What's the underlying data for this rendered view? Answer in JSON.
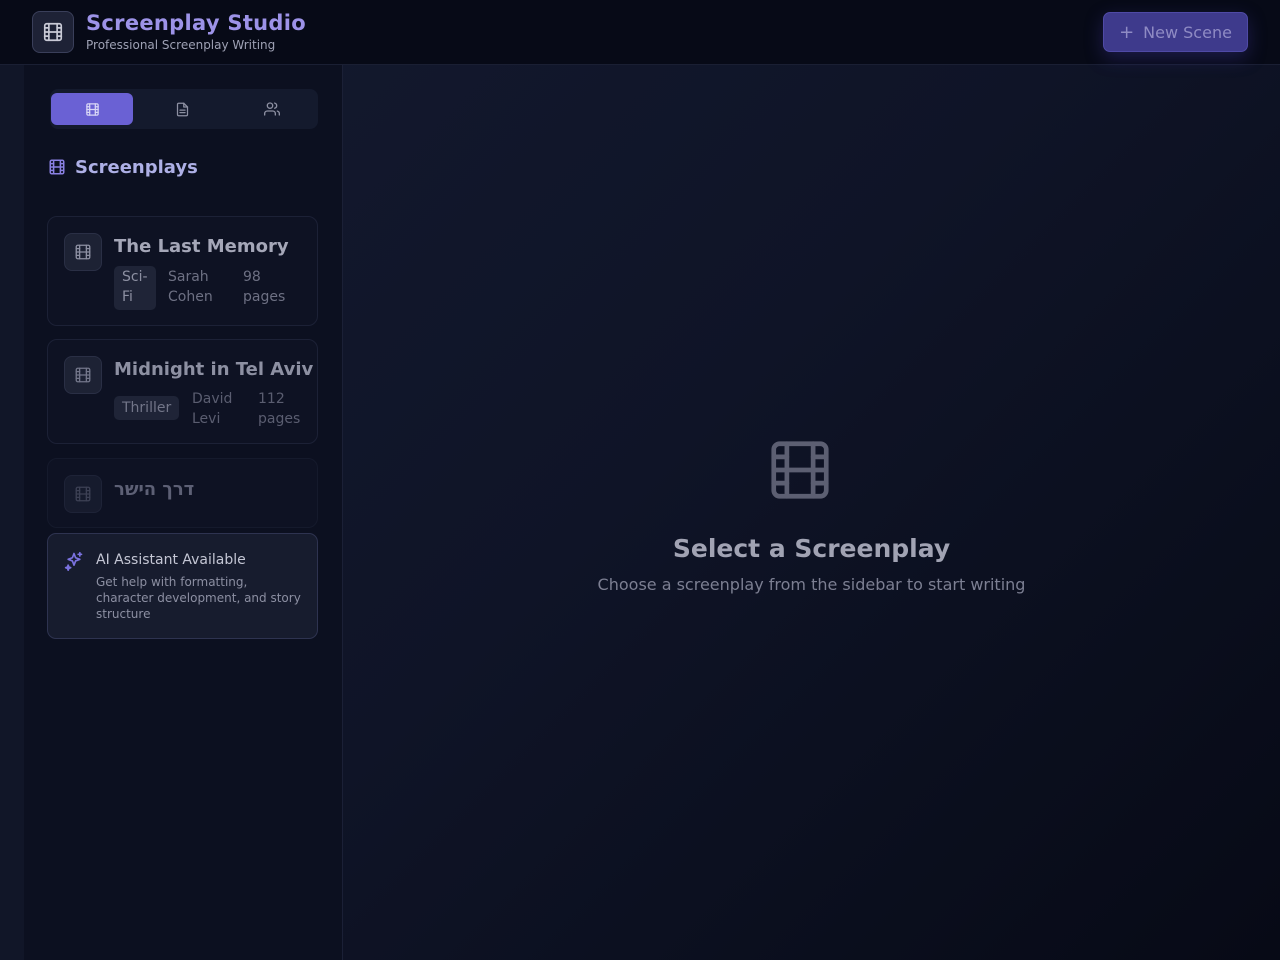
{
  "header": {
    "title": "Screenplay Studio",
    "subtitle": "Professional Screenplay Writing",
    "new_button_label": "New Scene",
    "logo_icon": "film-icon"
  },
  "sidebar": {
    "tabs": [
      {
        "icon": "film-icon",
        "active": true
      },
      {
        "icon": "document-icon",
        "active": false
      },
      {
        "icon": "users-icon",
        "active": false
      }
    ],
    "section_title": "Screenplays",
    "screenplays": [
      {
        "title": "The Last Memory",
        "genre_line1": "Sci-",
        "genre_line2": "Fi",
        "author_line1": "Sarah",
        "author_line2": "Cohen",
        "pages_line1": "98",
        "pages_line2": "pages"
      },
      {
        "title": "Midnight in Tel Aviv",
        "genre": "Thriller",
        "author_line1": "David",
        "author_line2": "Levi",
        "pages_line1": "112",
        "pages_line2": "pages"
      },
      {
        "title": "דרך הישר"
      }
    ],
    "ai": {
      "title": "AI Assistant Available",
      "description": "Get help with formatting, character development, and story structure",
      "icon": "sparkles-icon"
    }
  },
  "main": {
    "empty_title": "Select a Screenplay",
    "empty_subtitle": "Choose a screenplay from the sidebar to start writing",
    "empty_icon": "film-icon"
  },
  "colors": {
    "accent": "#6a61d4",
    "brand_title": "#9d93e8",
    "background": "#0f1427"
  }
}
